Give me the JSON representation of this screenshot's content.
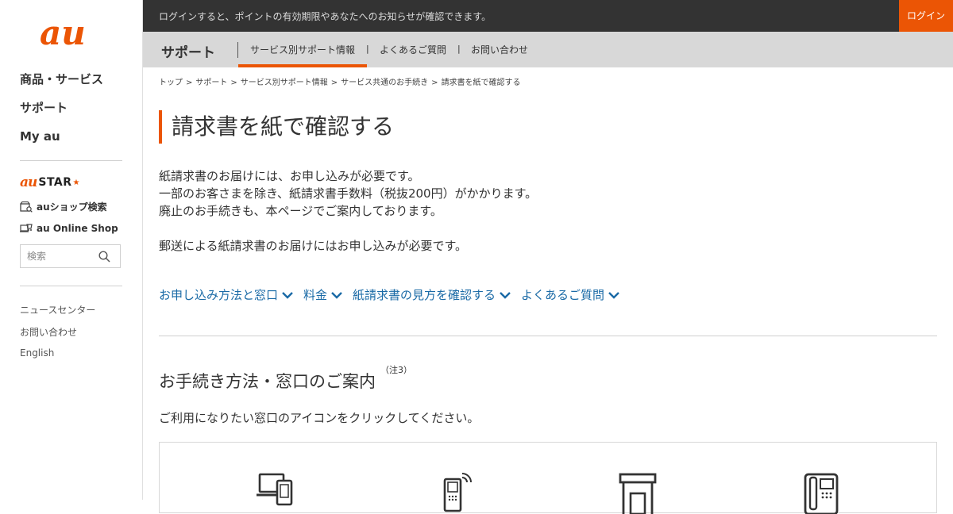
{
  "brand": {
    "logo_text": "au",
    "accent_color": "#eb5505"
  },
  "sidebar": {
    "main_nav": [
      "商品・サービス",
      "サポート",
      "My au"
    ],
    "austar": {
      "au": "au",
      "star": "STAR"
    },
    "links": [
      {
        "label": "auショップ検索",
        "icon": "shop-search-icon"
      },
      {
        "label": "au Online Shop",
        "icon": "online-shop-icon"
      }
    ],
    "search": {
      "placeholder": "検索"
    },
    "sub_links": [
      "ニュースセンター",
      "お問い合わせ",
      "English"
    ]
  },
  "topbar": {
    "message": "ログインすると、ポイントの有効期限やあなたへのお知らせが確認できます。",
    "login_label": "ログイン"
  },
  "subnav": {
    "title": "サポート",
    "tabs": [
      "サービス別サポート情報",
      "よくあるご質問",
      "お問い合わせ"
    ]
  },
  "breadcrumb": [
    "トップ",
    "サポート",
    "サービス別サポート情報",
    "サービス共通のお手続き",
    "請求書を紙で確認する"
  ],
  "breadcrumb_sep": ">",
  "page": {
    "title": "請求書を紙で確認する",
    "intro": [
      "紙請求書のお届けには、お申し込みが必要です。",
      "一部のお客さまを除き、紙請求書手数料（税抜200円）がかかります。",
      "廃止のお手続きも、本ページでご案内しております。",
      "郵送による紙請求書のお届けにはお申し込みが必要です。"
    ],
    "anchors": [
      "お申し込み方法と窓口",
      "料金",
      "紙請求書の見方を確認する",
      "よくあるご質問"
    ],
    "section": {
      "title": "お手続き方法・窓口のご案内",
      "note": "（注3）",
      "desc": "ご利用になりたい窓口のアイコンをクリックしてください。"
    },
    "channels": [
      {
        "icon": "pc-smartphone-icon"
      },
      {
        "icon": "mobile-phone-icon"
      },
      {
        "icon": "store-icon"
      },
      {
        "icon": "telephone-icon"
      }
    ]
  }
}
